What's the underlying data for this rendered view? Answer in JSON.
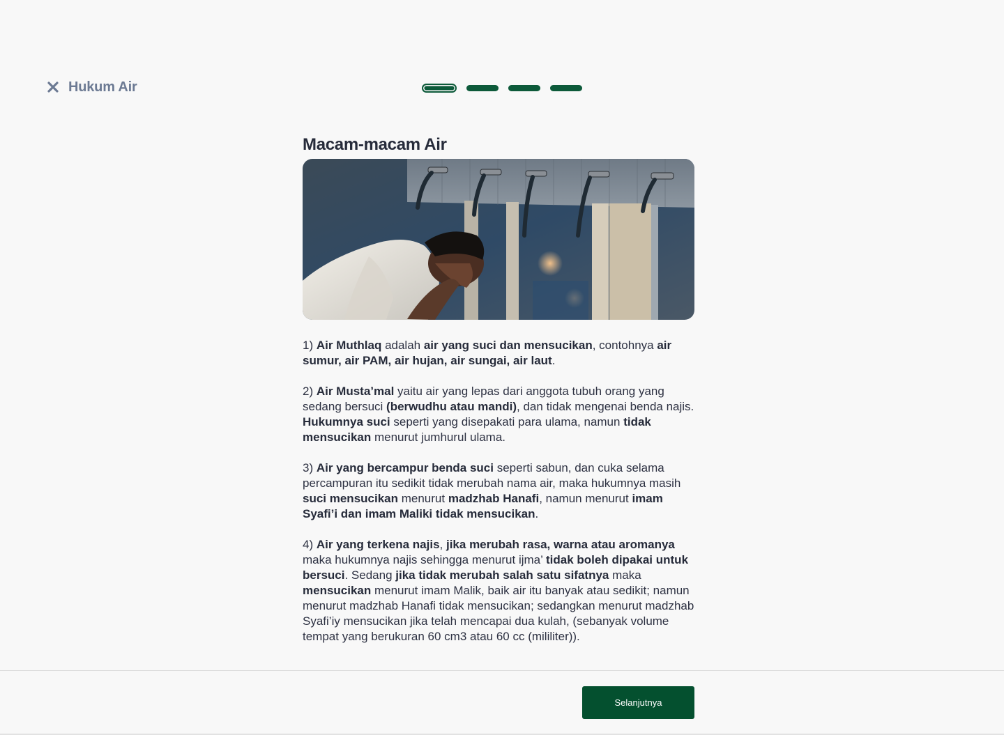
{
  "header": {
    "close_icon": "close-icon",
    "title": "Hukum Air"
  },
  "progress": {
    "total_steps": 4,
    "current_step": 1
  },
  "article": {
    "title": "Macam-macam Air",
    "image_alt": "Orang berwudhu di keran air",
    "paragraphs": [
      [
        {
          "t": "1) "
        },
        {
          "t": "Air Muthlaq",
          "b": true
        },
        {
          "t": " adalah "
        },
        {
          "t": "air yang suci dan mensucikan",
          "b": true
        },
        {
          "t": ", contohnya "
        },
        {
          "t": "air sumur, air PAM, air hujan, air sungai, air laut",
          "b": true
        },
        {
          "t": "."
        }
      ],
      [
        {
          "t": "2) "
        },
        {
          "t": "Air Musta’mal",
          "b": true
        },
        {
          "t": " yaitu air yang lepas dari anggota tubuh orang yang sedang bersuci "
        },
        {
          "t": "(berwudhu atau mandi)",
          "b": true
        },
        {
          "t": ", dan tidak mengenai benda najis. "
        },
        {
          "t": "Hukumnya suci",
          "b": true
        },
        {
          "t": " seperti yang disepakati para ulama, namun "
        },
        {
          "t": "tidak mensucikan",
          "b": true
        },
        {
          "t": " menurut jumhurul ulama."
        }
      ],
      [
        {
          "t": "3) "
        },
        {
          "t": "Air yang bercampur benda suci",
          "b": true
        },
        {
          "t": " seperti sabun, dan cuka selama percampuran itu sedikit tidak merubah nama air, maka hukumnya masih "
        },
        {
          "t": "suci mensucikan",
          "b": true
        },
        {
          "t": " menurut "
        },
        {
          "t": "madzhab Hanafi",
          "b": true
        },
        {
          "t": ", namun menurut "
        },
        {
          "t": "imam Syafi’i dan imam Maliki tidak mensucikan",
          "b": true
        },
        {
          "t": "."
        }
      ],
      [
        {
          "t": "4) "
        },
        {
          "t": "Air yang terkena najis",
          "b": true
        },
        {
          "t": ", "
        },
        {
          "t": "jika merubah rasa, warna atau aromanya",
          "b": true
        },
        {
          "t": " maka hukumnya najis sehingga menurut ijma’ "
        },
        {
          "t": "tidak boleh dipakai untuk bersuci",
          "b": true
        },
        {
          "t": ". Sedang "
        },
        {
          "t": "jika tidak merubah salah satu sifatnya",
          "b": true
        },
        {
          "t": " maka "
        },
        {
          "t": "mensucikan",
          "b": true
        },
        {
          "t": " menurut imam Malik, baik air itu banyak atau sedikit; namun menurut madzhab Hanafi tidak mensucikan; sedangkan menurut madzhab Syafi’iy mensucikan jika telah mencapai dua kulah, (sebanyak volume tempat yang berukuran 60 cm3 atau 60 cc (mililiter))."
        }
      ]
    ]
  },
  "footer": {
    "next_label": "Selanjutnya"
  },
  "colors": {
    "accent": "#04502f",
    "title_gray": "#6c7a93",
    "text": "#2d3142",
    "background": "#f8f8f8"
  }
}
